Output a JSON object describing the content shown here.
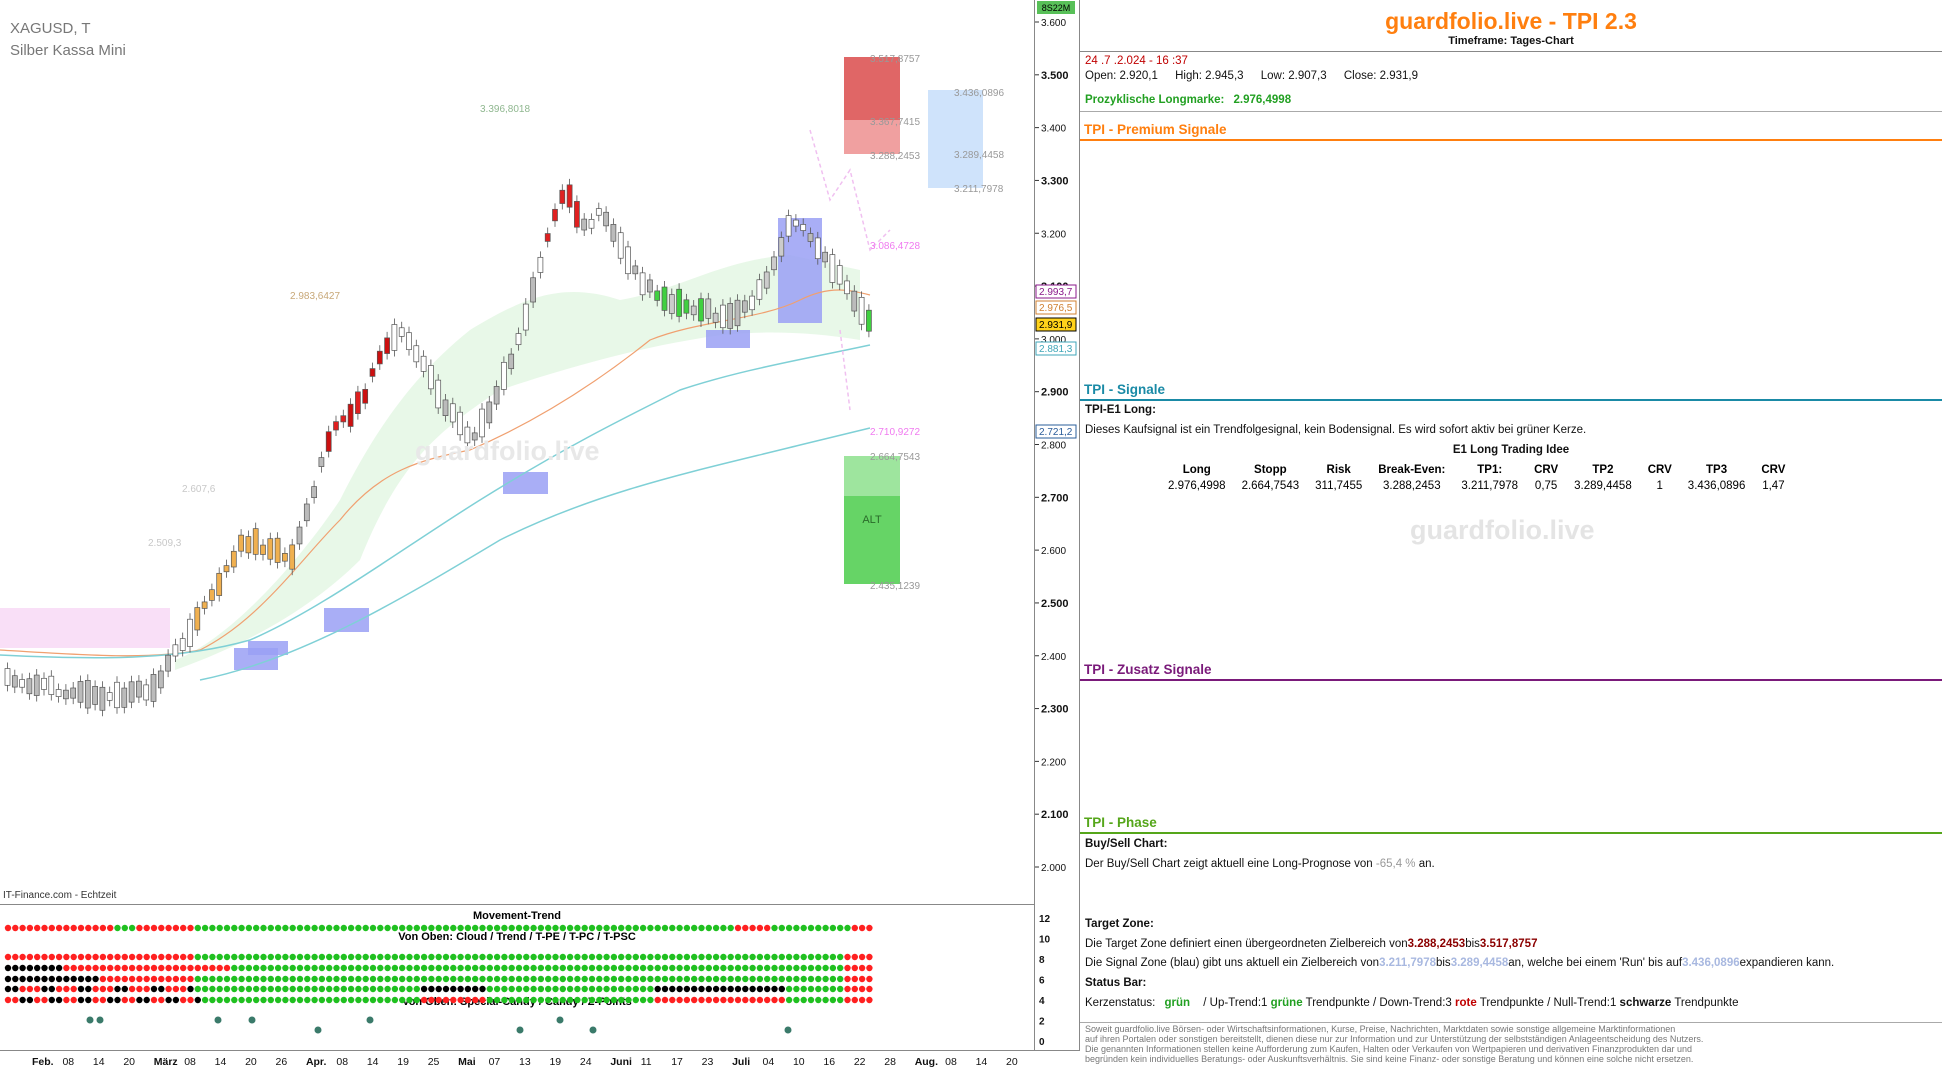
{
  "chart": {
    "symbol": "XAGUSD, T",
    "name": "Silber Kassa Mini",
    "source": "IT-Finance.com - Echtzeit",
    "watermark": "guardfolio.live",
    "price_ticks": [
      "3.600",
      "3.500",
      "3.400",
      "3.300",
      "3.200",
      "3.100",
      "3.000",
      "2.900",
      "2.800",
      "2.700",
      "2.600",
      "2.500",
      "2.400",
      "2.300",
      "2.200",
      "2.100",
      "2.000"
    ],
    "top_badge": "8S22M",
    "price_badges": [
      {
        "label": "2.993,7",
        "color": "#8b1a8b"
      },
      {
        "label": "2.976,5",
        "color": "#d08030"
      },
      {
        "label": "2.931,9",
        "color": "#000000"
      },
      {
        "label": "2.881,3",
        "color": "#3fa6b8"
      },
      {
        "label": "2.721,2",
        "color": "#2a5c9a"
      }
    ],
    "level_labels": {
      "l1": "3.517,8757",
      "l2": "3.367,7415",
      "l3": "3.288,2453",
      "l4": "3.436,0896",
      "l5": "3.289,4458",
      "l6": "3.211,7978",
      "l7": "3.086,4728",
      "l8": "2.710,9272",
      "l9": "2.664,7543",
      "l10": "2.435,1239",
      "l11": "3.396,8018",
      "l12": "2.983,6427",
      "l13": "2.607,6",
      "l14": "2.509,3"
    },
    "alt_label": "ALT",
    "indicator_titles": {
      "t1": "Movement-Trend",
      "t2": "Von Oben: Cloud / Trend / T-PE / T-PC / T-PSC",
      "t3": "Von Oben: Special-Candy / Candy / Z-Points"
    },
    "indicator_ticks": [
      "12",
      "10",
      "8",
      "6",
      "4",
      "2",
      "0"
    ],
    "time_labels": [
      "Feb.",
      "08",
      "14",
      "20",
      "März",
      "08",
      "14",
      "20",
      "26",
      "Apr.",
      "08",
      "14",
      "19",
      "25",
      "Mai",
      "07",
      "13",
      "19",
      "24",
      "Juni",
      "11",
      "17",
      "23",
      "Juli",
      "04",
      "10",
      "16",
      "22",
      "28",
      "Aug.",
      "08",
      "14",
      "20"
    ]
  },
  "info": {
    "title": "guardfolio.live - TPI 2.3",
    "timeframe": "Timeframe: Tages-Chart",
    "datetime": "24 .7 .2.024  - 16 :37",
    "open_label": "Open:",
    "open": "2.920,1",
    "high_label": "High:",
    "high": "2.945,3",
    "low_label": "Low:",
    "low": "2.907,3",
    "close_label": "Close:",
    "close": "2.931,9",
    "longmarke_label": "Prozyklische Longmarke:",
    "longmarke": "2.976,4998",
    "sec_premium": "TPI - Premium Signale",
    "sec_signale": "TPI - Signale",
    "sig_title": "TPI-E1 Long:",
    "sig_text": "Dieses Kaufsignal ist ein Trendfolgesignal, kein Bodensignal. Es wird sofort aktiv bei grüner Kerze.",
    "idea_title": "E1 Long Trading Idee",
    "trade_headers": [
      "Long",
      "Stopp",
      "Risk",
      "Break-Even:",
      "TP1:",
      "CRV",
      "TP2",
      "CRV",
      "TP3",
      "CRV"
    ],
    "trade_values": [
      "2.976,4998",
      "2.664,7543",
      "311,7455",
      "3.288,2453",
      "3.211,7978",
      "0,75",
      "3.289,4458",
      "1",
      "3.436,0896",
      "1,47"
    ],
    "watermark": "guardfolio.live",
    "sec_zusatz": "TPI - Zusatz Signale",
    "sec_phase": "TPI - Phase",
    "bs_title": "Buy/Sell Chart:",
    "bs_text1": "Der Buy/Sell Chart zeigt aktuell eine Long-Prognose von",
    "bs_value": "-65,4 %",
    "bs_text2": "an.",
    "tz_title": "Target Zone:",
    "tz_text1": "Die Target Zone definiert einen übergeordneten Zielbereich von",
    "tz_v1": "3.288,2453",
    "tz_text2": "bis",
    "tz_v2": "3.517,8757",
    "sz_text1": "Die Signal Zone (blau) gibt uns aktuell ein Zielbereich von",
    "sz_v1": "3.211,7978",
    "sz_text2": "bis",
    "sz_v2": "3.289,4458",
    "sz_text3": "an, welche bei einem 'Run' bis auf",
    "sz_v3": "3.436,0896",
    "sz_text4": "expandieren kann.",
    "status_title": "Status Bar:",
    "kern_label": "Kerzenstatus:",
    "kern_value": "grün",
    "kern_up1": "/ Up-Trend:",
    "kern_up_n": "1",
    "kern_up_col": "grüne",
    "kern_tp1": "Trendpunkte",
    "kern_down1": "/ Down-Trend:",
    "kern_down_n": "3",
    "kern_down_col": "rote",
    "kern_tp2": "Trendpunkte",
    "kern_null1": "/ Null-Trend:",
    "kern_null_n": "1",
    "kern_null_col": "schwarze",
    "kern_tp3": "Trendpunkte",
    "disclaimer": [
      "Soweit guardfolio.live Börsen- oder Wirtschaftsinformationen, Kurse, Preise, Nachrichten, Marktdaten sowie sonstige allgemeine Marktinformationen",
      "auf ihren Portalen oder sonstigen bereitstellt, dienen diese nur zur Information und zur Unterstützung der selbstständigen Anlageentscheidung des Nutzers.",
      "Die genannten Informationen stellen keine Aufforderung zum Kaufen, Halten oder Verkaufen von Wertpapieren und derivativen Finanzprodukten dar und",
      "begründen kein individuelles Beratungs- oder Auskunftsverhältnis. Sie sind keine Finanz- oder sonstige Beratung und können eine solche nicht ersetzen."
    ],
    "colors": {
      "orange": "#ff7f0f",
      "teal": "#1a8aa6",
      "purple": "#7a1a7a",
      "green": "#55a61a",
      "signal_green": "#22a022",
      "red_text": "#c00000"
    }
  }
}
